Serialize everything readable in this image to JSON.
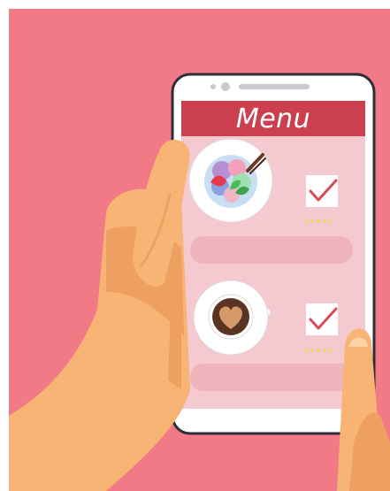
{
  "screen": {
    "title": "Menu"
  },
  "menu_items": [
    {
      "name": "ice-cream-bowl",
      "checked": true,
      "rating_stars": 5
    },
    {
      "name": "latte-heart",
      "checked": true,
      "rating_stars": 5
    }
  ],
  "colors": {
    "background": "#f27a86",
    "phone_body": "#ffffff",
    "phone_outline": "#2d2d38",
    "header_bar": "#cc3f4e",
    "screen_bg": "#f4c9cf",
    "placeholder_bar": "#efb4bc",
    "checkmark": "#d64b57",
    "star": "#f5da42",
    "skin": "#f8b474",
    "skin_shadow": "#eea062",
    "coffee": "#5a3423",
    "foam": "#d69a6a"
  }
}
